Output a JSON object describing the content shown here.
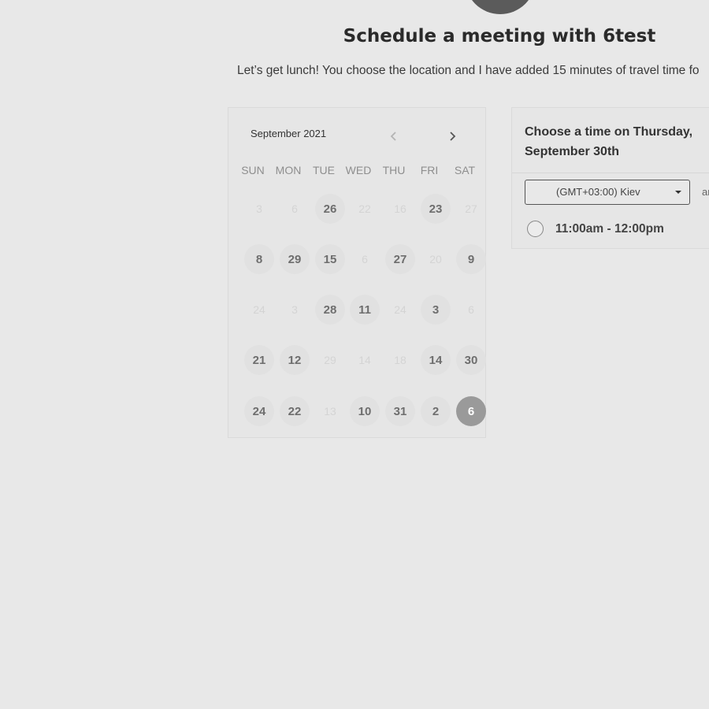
{
  "header": {
    "title": "Schedule a meeting with 6test",
    "description": "Let’s get lunch! You choose the location and I have added 15 minutes of travel time fo"
  },
  "calendar": {
    "month_label": "September 2021",
    "weekdays": [
      "SUN",
      "MON",
      "TUE",
      "WED",
      "THU",
      "FRI",
      "SAT"
    ],
    "weeks": [
      [
        {
          "label": "3",
          "state": "unavailable"
        },
        {
          "label": "6",
          "state": "unavailable"
        },
        {
          "label": "26",
          "state": "available"
        },
        {
          "label": "22",
          "state": "unavailable"
        },
        {
          "label": "16",
          "state": "unavailable"
        },
        {
          "label": "23",
          "state": "available"
        },
        {
          "label": "27",
          "state": "unavailable"
        }
      ],
      [
        {
          "label": "8",
          "state": "available"
        },
        {
          "label": "29",
          "state": "available"
        },
        {
          "label": "15",
          "state": "available"
        },
        {
          "label": "6",
          "state": "unavailable"
        },
        {
          "label": "27",
          "state": "available"
        },
        {
          "label": "20",
          "state": "unavailable"
        },
        {
          "label": "9",
          "state": "available"
        }
      ],
      [
        {
          "label": "24",
          "state": "unavailable"
        },
        {
          "label": "3",
          "state": "unavailable"
        },
        {
          "label": "28",
          "state": "available"
        },
        {
          "label": "11",
          "state": "available"
        },
        {
          "label": "24",
          "state": "unavailable"
        },
        {
          "label": "3",
          "state": "available"
        },
        {
          "label": "6",
          "state": "unavailable"
        }
      ],
      [
        {
          "label": "21",
          "state": "available"
        },
        {
          "label": "12",
          "state": "available"
        },
        {
          "label": "29",
          "state": "unavailable"
        },
        {
          "label": "14",
          "state": "unavailable"
        },
        {
          "label": "18",
          "state": "unavailable"
        },
        {
          "label": "14",
          "state": "available"
        },
        {
          "label": "30",
          "state": "available"
        }
      ],
      [
        {
          "label": "24",
          "state": "available"
        },
        {
          "label": "22",
          "state": "available"
        },
        {
          "label": "13",
          "state": "unavailable"
        },
        {
          "label": "10",
          "state": "available"
        },
        {
          "label": "31",
          "state": "available"
        },
        {
          "label": "2",
          "state": "available"
        },
        {
          "label": "6",
          "state": "selected"
        }
      ]
    ]
  },
  "time_panel": {
    "heading": "Choose a time on Thursday, September 30th",
    "timezone": "(GMT+03:00) Kiev",
    "timezone_extra": "ar",
    "slots": [
      "11:00am - 12:00pm"
    ]
  },
  "icons": {
    "prev": "chevron-left-icon",
    "next": "chevron-right-icon",
    "dropdown": "caret-down-icon"
  },
  "colors": {
    "background": "#e8e8e8",
    "selected_day": "#9a9a9a",
    "available_day": "#e1e1e1"
  }
}
